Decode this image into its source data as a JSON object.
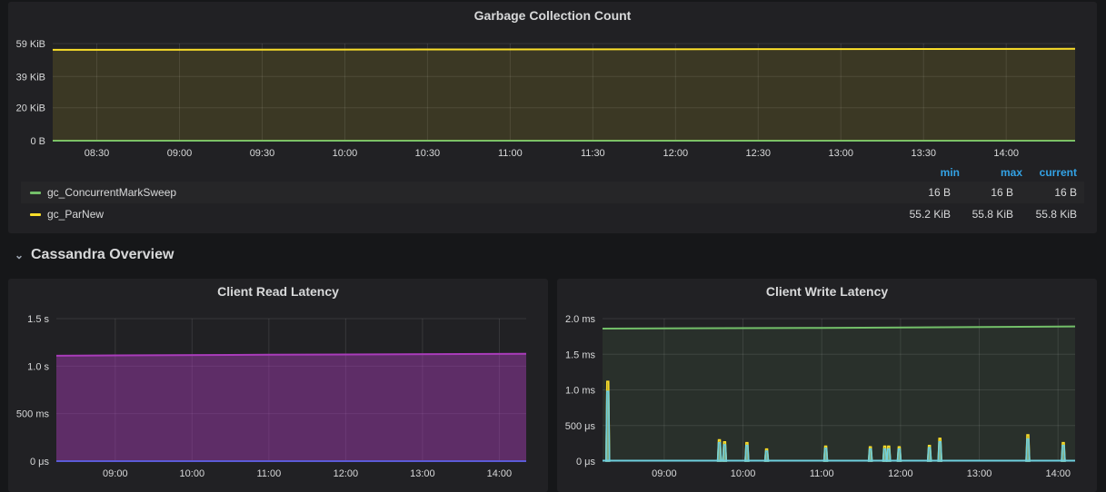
{
  "panels": {
    "gc": {
      "title": "Garbage Collection Count",
      "legend": {
        "headers": {
          "min": "min",
          "max": "max",
          "current": "current"
        },
        "series": [
          {
            "name": "gc_ConcurrentMarkSweep",
            "color": "#73bf69",
            "min": "16 B",
            "max": "16 B",
            "current": "16 B"
          },
          {
            "name": "gc_ParNew",
            "color": "#fade2a",
            "min": "55.2 KiB",
            "max": "55.8 KiB",
            "current": "55.8 KiB"
          }
        ]
      }
    },
    "read": {
      "title": "Client Read Latency"
    },
    "write": {
      "title": "Client Write Latency"
    }
  },
  "row": {
    "title": "Cassandra Overview",
    "icon": "chevron-down-icon"
  },
  "chart_data": [
    {
      "type": "area",
      "title": "Garbage Collection Count",
      "y_unit": "KiB",
      "ylim": [
        0,
        59
      ],
      "yticks": [
        {
          "v": 0,
          "label": "0 B"
        },
        {
          "v": 20,
          "label": "20 KiB"
        },
        {
          "v": 39,
          "label": "39 KiB"
        },
        {
          "v": 59,
          "label": "59 KiB"
        }
      ],
      "xlim": [
        "08:14",
        "14:25"
      ],
      "xticks": [
        "08:30",
        "09:00",
        "09:30",
        "10:00",
        "10:30",
        "11:00",
        "11:30",
        "12:00",
        "12:30",
        "13:00",
        "13:30",
        "14:00"
      ],
      "grid": true,
      "series": [
        {
          "name": "gc_ConcurrentMarkSweep",
          "color": "#73bf69",
          "fill": false,
          "points": [
            [
              "08:14",
              0.016
            ],
            [
              "14:25",
              0.016
            ]
          ]
        },
        {
          "name": "gc_ParNew",
          "color": "#fade2a",
          "fill": true,
          "points": [
            [
              "08:14",
              55.2
            ],
            [
              "10:30",
              55.4
            ],
            [
              "12:30",
              55.6
            ],
            [
              "14:25",
              55.8
            ]
          ]
        }
      ]
    },
    {
      "type": "area",
      "title": "Client Read Latency",
      "y_unit": "s",
      "ylim": [
        0,
        1.5
      ],
      "yticks": [
        {
          "v": 0,
          "label": "0 μs"
        },
        {
          "v": 0.5,
          "label": "500 ms"
        },
        {
          "v": 1.0,
          "label": "1.0 s"
        },
        {
          "v": 1.5,
          "label": "1.5 s"
        }
      ],
      "xlim": [
        "08:14",
        "14:21"
      ],
      "xticks": [
        "09:00",
        "10:00",
        "11:00",
        "12:00",
        "13:00",
        "14:00"
      ],
      "grid": true,
      "series": [
        {
          "color": "#a93cba",
          "fill": true,
          "points": [
            [
              "08:14",
              1.11
            ],
            [
              "11:00",
              1.12
            ],
            [
              "14:21",
              1.13
            ]
          ]
        },
        {
          "color": "#5b5bd6",
          "fill": false,
          "points": [
            [
              "08:14",
              0.0
            ],
            [
              "14:21",
              0.0
            ]
          ]
        }
      ]
    },
    {
      "type": "area",
      "title": "Client Write Latency",
      "y_unit": "ms",
      "ylim": [
        0,
        2.0
      ],
      "yticks": [
        {
          "v": 0,
          "label": "0 μs"
        },
        {
          "v": 0.5,
          "label": "500 μs"
        },
        {
          "v": 1.0,
          "label": "1.0 ms"
        },
        {
          "v": 1.5,
          "label": "1.5 ms"
        },
        {
          "v": 2.0,
          "label": "2.0 ms"
        }
      ],
      "xlim": [
        "08:13",
        "14:13"
      ],
      "xticks": [
        "09:00",
        "10:00",
        "11:00",
        "12:00",
        "13:00",
        "14:00"
      ],
      "grid": true,
      "series": [
        {
          "color": "#73bf69",
          "fill": true,
          "points": [
            [
              "08:13",
              1.86
            ],
            [
              "11:00",
              1.87
            ],
            [
              "14:13",
              1.89
            ]
          ]
        },
        {
          "color": "#fade2a",
          "fill": false,
          "spikes": true,
          "points": [
            [
              "08:17",
              1.12
            ],
            [
              "09:42",
              0.3
            ],
            [
              "09:46",
              0.27
            ],
            [
              "10:03",
              0.26
            ],
            [
              "10:18",
              0.17
            ],
            [
              "11:03",
              0.21
            ],
            [
              "11:37",
              0.2
            ],
            [
              "11:48",
              0.21
            ],
            [
              "11:51",
              0.21
            ],
            [
              "11:59",
              0.2
            ],
            [
              "12:22",
              0.22
            ],
            [
              "12:30",
              0.32
            ],
            [
              "13:37",
              0.37
            ],
            [
              "14:04",
              0.26
            ]
          ]
        },
        {
          "color": "#6ed0e0",
          "fill": false,
          "spikes": true,
          "points": [
            [
              "08:17",
              0.98
            ],
            [
              "09:42",
              0.26
            ],
            [
              "09:46",
              0.23
            ],
            [
              "10:03",
              0.22
            ],
            [
              "10:18",
              0.14
            ],
            [
              "11:03",
              0.18
            ],
            [
              "11:37",
              0.17
            ],
            [
              "11:48",
              0.17
            ],
            [
              "11:51",
              0.17
            ],
            [
              "11:59",
              0.17
            ],
            [
              "12:22",
              0.19
            ],
            [
              "12:30",
              0.27
            ],
            [
              "13:37",
              0.31
            ],
            [
              "14:04",
              0.22
            ]
          ]
        }
      ]
    }
  ]
}
